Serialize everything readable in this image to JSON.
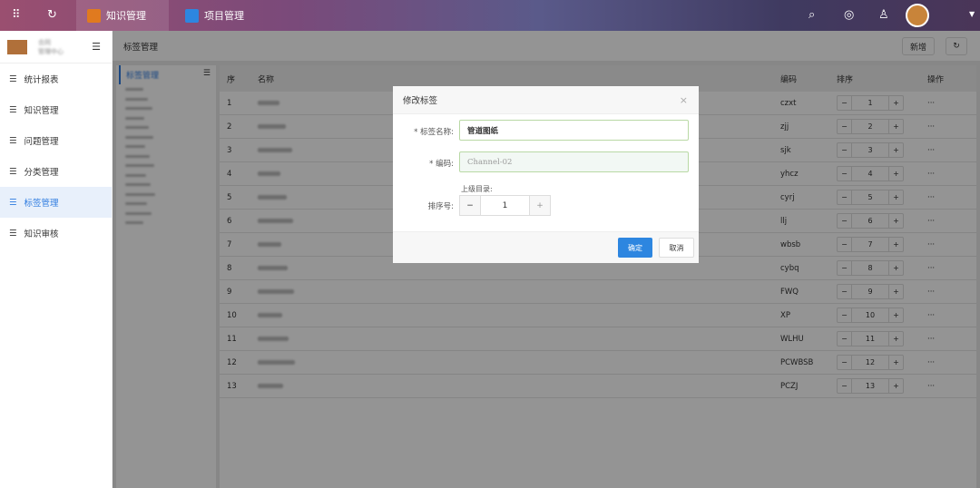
{
  "topbar": {
    "apps": [
      {
        "label": "知识管理",
        "color": "#e07a1f"
      },
      {
        "label": "项目管理",
        "color": "#2d86e0"
      }
    ]
  },
  "sidebar": {
    "user_line1": "合同",
    "user_line2": "管理中心",
    "items": [
      {
        "label": "统计报表"
      },
      {
        "label": "知识管理"
      },
      {
        "label": "问题管理"
      },
      {
        "label": "分类管理"
      },
      {
        "label": "标签管理",
        "active": true
      },
      {
        "label": "知识审核"
      }
    ]
  },
  "page": {
    "title": "标签管理",
    "add_label": "新增"
  },
  "tree": {
    "root": "标签管理"
  },
  "table": {
    "headers": {
      "index": "序",
      "name": "名称",
      "code": "编码",
      "sort": "排序",
      "action": "操作"
    },
    "rows": [
      {
        "i": "1",
        "code": "czxt",
        "sort": "1"
      },
      {
        "i": "2",
        "code": "zjj",
        "sort": "2"
      },
      {
        "i": "3",
        "code": "sjk",
        "sort": "3"
      },
      {
        "i": "4",
        "code": "yhcz",
        "sort": "4"
      },
      {
        "i": "5",
        "code": "cyrj",
        "sort": "5"
      },
      {
        "i": "6",
        "code": "llj",
        "sort": "6"
      },
      {
        "i": "7",
        "code": "wbsb",
        "sort": "7"
      },
      {
        "i": "8",
        "code": "cybq",
        "sort": "8"
      },
      {
        "i": "9",
        "code": "FWQ",
        "sort": "9"
      },
      {
        "i": "10",
        "code": "XP",
        "sort": "10"
      },
      {
        "i": "11",
        "code": "WLHU",
        "sort": "11"
      },
      {
        "i": "12",
        "code": "PCWBSB",
        "sort": "12"
      },
      {
        "i": "13",
        "code": "PCZJ",
        "sort": "13"
      }
    ],
    "action_label": "···"
  },
  "dialog": {
    "title": "修改标签",
    "name_label": "* 标签名称:",
    "name_value": "管道图纸",
    "code_label": "* 编码:",
    "code_placeholder": "Channel-02",
    "parent_label": "上级目录:",
    "sort_label": "排序号:",
    "sort_value": "1",
    "minus": "−",
    "plus": "+",
    "ok": "确定",
    "cancel": "取消",
    "close": "×"
  }
}
